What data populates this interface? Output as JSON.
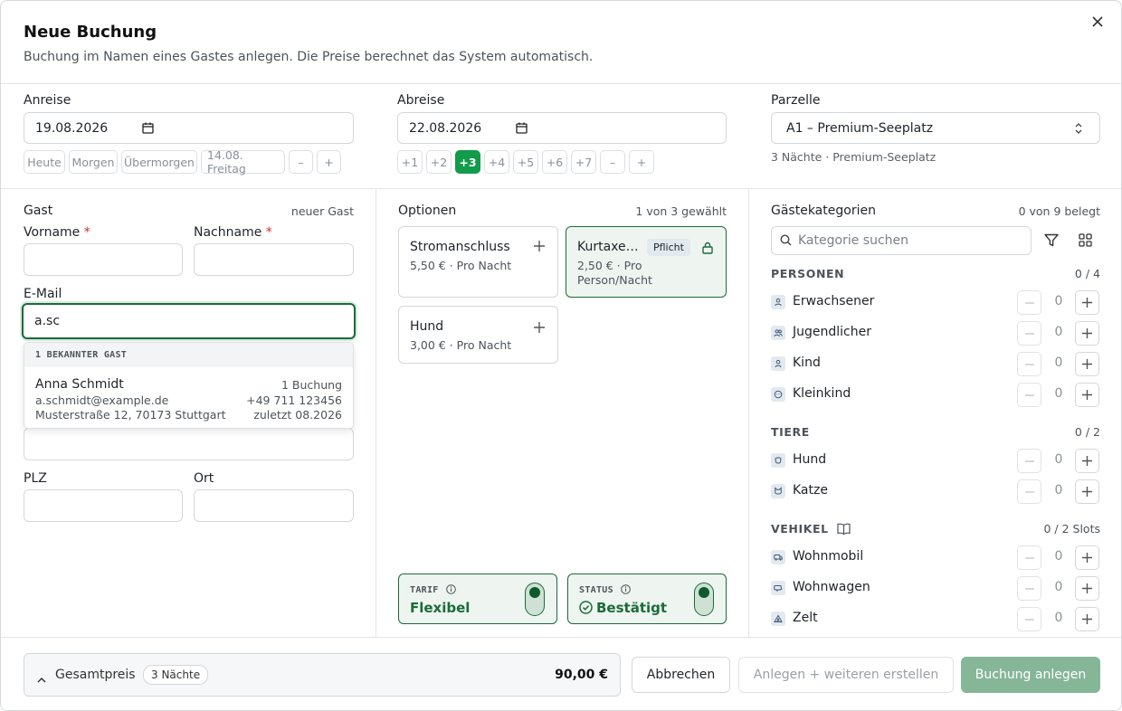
{
  "header": {
    "title": "Neue Buchung",
    "subtitle": "Buchung im Namen eines Gastes anlegen. Die Preise berechnet das System automatisch.",
    "close_label": "×"
  },
  "dates": {
    "arrival_label": "Anreise",
    "arrival_value": "19.08.2026",
    "arrival_chips": [
      "Heute",
      "Morgen",
      "Übermorgen",
      "14.08. Freitag",
      "–",
      "+"
    ],
    "departure_label": "Abreise",
    "departure_value": "22.08.2026",
    "departure_chips": [
      "+1",
      "+2",
      "+3",
      "+4",
      "+5",
      "+6",
      "+7",
      "–",
      "+"
    ],
    "departure_selected": "+3",
    "pitch_label": "Parzelle",
    "pitch_value": "A1 – Premium-Seeplatz",
    "pitch_hint": "3 Nächte · Premium-Seeplatz"
  },
  "guest": {
    "heading": "Gast",
    "status": "neuer Gast",
    "firstname_label": "Vorname",
    "lastname_label": "Nachname",
    "required_mark": "*",
    "email_label": "E-Mail",
    "email_value": "a.sc",
    "plz_label": "PLZ",
    "city_label": "Ort",
    "suggestions": {
      "heading": "1 BEKANNTER GAST",
      "name": "Anna Schmidt",
      "bookings": "1 Buchung",
      "email": "a.schmidt@example.de",
      "phone": "+49 711 123456",
      "address": "Musterstraße 12, 70173 Stuttgart",
      "last": "zuletzt 08.2026"
    }
  },
  "options": {
    "heading": "Optionen",
    "count": "1 von 3 gewählt",
    "items": [
      {
        "name": "Stromanschluss",
        "price": "5,50 € · Pro Nacht"
      },
      {
        "name": "Kurtaxe…",
        "price_line1": "2,50 € · Pro",
        "price_line2": "Person/Nacht",
        "badge": "Pflicht"
      },
      {
        "name": "Hund",
        "price": "3,00 € · Pro Nacht"
      }
    ],
    "tariff_label": "TARIF",
    "tariff_value": "Flexibel",
    "status_label": "STATUS",
    "status_value": "Bestätigt"
  },
  "categories": {
    "heading": "Gästekategorien",
    "count": "0 von 9 belegt",
    "search_placeholder": "Kategorie suchen",
    "groups": {
      "persons": {
        "label": "PERSONEN",
        "count": "0 / 4"
      },
      "animals": {
        "label": "TIERE",
        "count": "0 / 2"
      },
      "vehicles": {
        "label": "VEHIKEL",
        "count": "0 / 2 Slots"
      }
    },
    "items": [
      {
        "name": "Erwachsener",
        "value": "0",
        "icon": "person-icon"
      },
      {
        "name": "Jugendlicher",
        "value": "0",
        "icon": "people-icon"
      },
      {
        "name": "Kind",
        "value": "0",
        "icon": "child-icon"
      },
      {
        "name": "Kleinkind",
        "value": "0",
        "icon": "baby-icon"
      },
      {
        "name": "Hund",
        "value": "0",
        "icon": "dog-icon"
      },
      {
        "name": "Katze",
        "value": "0",
        "icon": "cat-icon"
      },
      {
        "name": "Wohnmobil",
        "value": "0",
        "icon": "camper-icon"
      },
      {
        "name": "Wohnwagen",
        "value": "0",
        "icon": "caravan-icon"
      },
      {
        "name": "Zelt",
        "value": "0",
        "icon": "tent-icon"
      }
    ]
  },
  "footer": {
    "total_label": "Gesamtpreis",
    "nights_badge": "3 Nächte",
    "total_value": "90,00 €",
    "cancel_label": "Abbrechen",
    "create_more_label": "Anlegen + weiteren erstellen",
    "submit_label": "Buchung anlegen"
  },
  "colors": {
    "accent": "#129b4a",
    "accent_dark": "#1b6b3a",
    "submit_disabled": "#86b698",
    "required": "#d32f2f"
  }
}
